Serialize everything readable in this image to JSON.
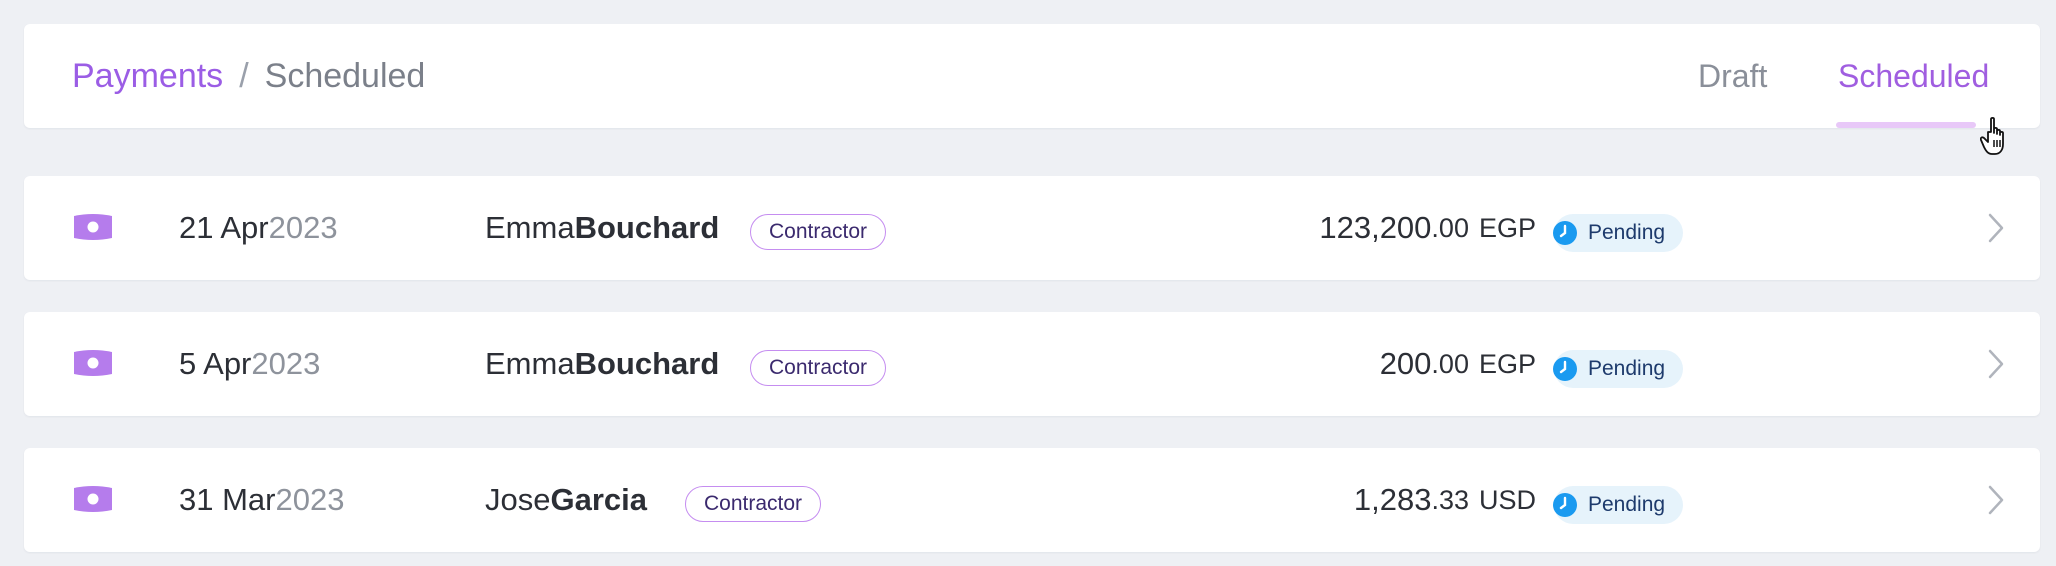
{
  "breadcrumb": {
    "parent": "Payments",
    "separator": "/",
    "current": "Scheduled"
  },
  "tabs": [
    {
      "label": "Draft",
      "active": false
    },
    {
      "label": "Scheduled",
      "active": true
    }
  ],
  "colors": {
    "accent": "#9b5de5",
    "pending_bg": "#e6f3fb",
    "pending_icon": "#1a9af0"
  },
  "payments": [
    {
      "icon": "cash-icon",
      "date_day_month": "21 Apr",
      "date_year": "2023",
      "first_name": "Emma",
      "last_name": "Bouchard",
      "tag": "Contractor",
      "amount_whole": "123,200",
      "amount_cents": ".00",
      "currency": "EGP",
      "status": "Pending"
    },
    {
      "icon": "cash-icon",
      "date_day_month": "5 Apr",
      "date_year": "2023",
      "first_name": "Emma",
      "last_name": "Bouchard",
      "tag": "Contractor",
      "amount_whole": "200",
      "amount_cents": ".00",
      "currency": "EGP",
      "status": "Pending"
    },
    {
      "icon": "cash-icon",
      "date_day_month": "31 Mar",
      "date_year": "2023",
      "first_name": "Jose",
      "last_name": "Garcia",
      "tag": "Contractor",
      "amount_whole": "1,283",
      "amount_cents": ".33",
      "currency": "USD",
      "status": "Pending"
    }
  ]
}
